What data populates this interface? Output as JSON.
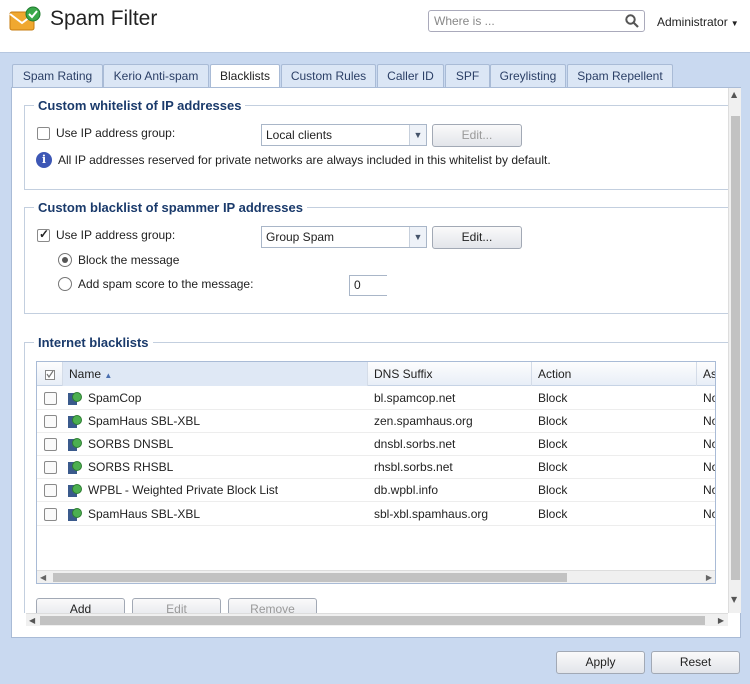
{
  "app": {
    "title": "Spam Filter"
  },
  "search": {
    "placeholder": "Where is ..."
  },
  "user": {
    "name": "Administrator"
  },
  "tabs": [
    {
      "label": "Spam Rating"
    },
    {
      "label": "Kerio Anti-spam"
    },
    {
      "label": "Blacklists",
      "active": true
    },
    {
      "label": "Custom Rules"
    },
    {
      "label": "Caller ID"
    },
    {
      "label": "SPF"
    },
    {
      "label": "Greylisting"
    },
    {
      "label": "Spam Repellent"
    }
  ],
  "whitelist": {
    "legend": "Custom whitelist of IP addresses",
    "use_group_label": "Use IP address group:",
    "use_group_checked": false,
    "group_value": "Local clients",
    "edit_label": "Edit...",
    "info_text": "All IP addresses reserved for private networks are always included in this whitelist by default."
  },
  "blacklist": {
    "legend": "Custom blacklist of spammer IP addresses",
    "use_group_label": "Use IP address group:",
    "use_group_checked": true,
    "group_value": "Group Spam",
    "edit_label": "Edit...",
    "block_label": "Block the message",
    "add_score_label": "Add spam score to the message:",
    "selected_option": "block",
    "score_value": "0"
  },
  "internet_blacklists": {
    "legend": "Internet blacklists",
    "columns": [
      "Name",
      "DNS Suffix",
      "Action",
      "As"
    ],
    "rows": [
      {
        "name": "SpamCop",
        "dns": "bl.spamcop.net",
        "action": "Block",
        "as": "No"
      },
      {
        "name": "SpamHaus SBL-XBL",
        "dns": "zen.spamhaus.org",
        "action": "Block",
        "as": "No"
      },
      {
        "name": "SORBS DNSBL",
        "dns": "dnsbl.sorbs.net",
        "action": "Block",
        "as": "No"
      },
      {
        "name": "SORBS RHSBL",
        "dns": "rhsbl.sorbs.net",
        "action": "Block",
        "as": "No"
      },
      {
        "name": "WPBL - Weighted Private Block List",
        "dns": "db.wpbl.info",
        "action": "Block",
        "as": "No"
      },
      {
        "name": "SpamHaus SBL-XBL",
        "dns": "sbl-xbl.spamhaus.org",
        "action": "Block",
        "as": "No"
      }
    ],
    "add_label": "Add",
    "edit_label": "Edit",
    "remove_label": "Remove"
  },
  "footer": {
    "apply_label": "Apply",
    "reset_label": "Reset"
  },
  "colors": {
    "accent": "#1a3a6b",
    "panel_bg": "#c9d9f0",
    "info": "#3d57b5"
  }
}
